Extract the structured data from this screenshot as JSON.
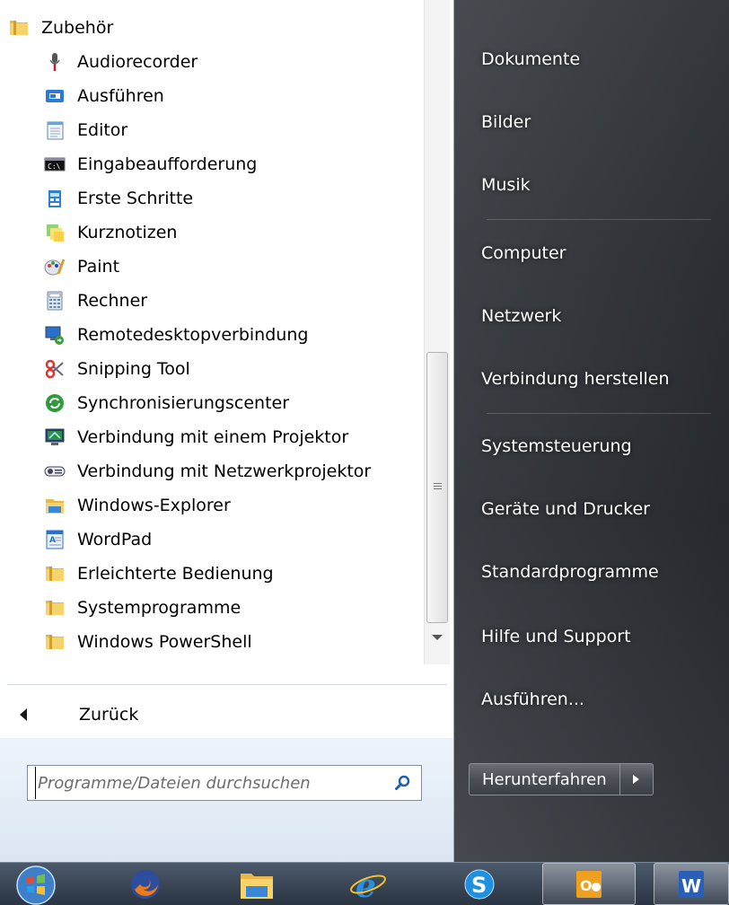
{
  "programs": {
    "folder_title": "Zubehör",
    "items": [
      {
        "label": "Audiorecorder",
        "icon": "microphone-icon"
      },
      {
        "label": "Ausführen",
        "icon": "run-icon"
      },
      {
        "label": "Editor",
        "icon": "notepad-icon"
      },
      {
        "label": "Eingabeaufforderung",
        "icon": "command-prompt-icon"
      },
      {
        "label": "Erste Schritte",
        "icon": "getting-started-icon"
      },
      {
        "label": "Kurznotizen",
        "icon": "sticky-notes-icon"
      },
      {
        "label": "Paint",
        "icon": "paint-icon"
      },
      {
        "label": "Rechner",
        "icon": "calculator-icon"
      },
      {
        "label": "Remotedesktopverbindung",
        "icon": "remote-desktop-icon"
      },
      {
        "label": "Snipping Tool",
        "icon": "scissors-icon"
      },
      {
        "label": "Synchronisierungscenter",
        "icon": "sync-center-icon"
      },
      {
        "label": "Verbindung mit einem Projektor",
        "icon": "projector-icon"
      },
      {
        "label": "Verbindung mit Netzwerkprojektor",
        "icon": "network-projector-icon"
      },
      {
        "label": "Windows-Explorer",
        "icon": "explorer-folder-icon"
      },
      {
        "label": "WordPad",
        "icon": "wordpad-icon"
      }
    ],
    "folders": [
      {
        "label": "Erleichterte Bedienung"
      },
      {
        "label": "Systemprogramme"
      },
      {
        "label": "Windows PowerShell"
      }
    ]
  },
  "back_label": "Zurück",
  "search": {
    "placeholder": "Programme/Dateien durchsuchen"
  },
  "right_links": [
    {
      "label": "Dokumente"
    },
    {
      "label": "Bilder"
    },
    {
      "label": "Musik"
    },
    {
      "label": "Computer"
    },
    {
      "label": "Netzwerk"
    },
    {
      "label": "Verbindung herstellen"
    },
    {
      "label": "Systemsteuerung"
    },
    {
      "label": "Geräte und Drucker"
    },
    {
      "label": "Standardprogramme"
    },
    {
      "label": "Hilfe und Support"
    },
    {
      "label": "Ausführen..."
    }
  ],
  "shutdown_label": "Herunterfahren",
  "taskbar": [
    "start-orb-icon",
    "firefox-icon",
    "file-explorer-icon",
    "internet-explorer-icon",
    "skype-icon",
    "outlook-icon",
    "word-icon"
  ],
  "colors": {
    "accent": "#1e6fd0",
    "menu_bg": "#ffffff",
    "right_pane": "#33363c"
  }
}
